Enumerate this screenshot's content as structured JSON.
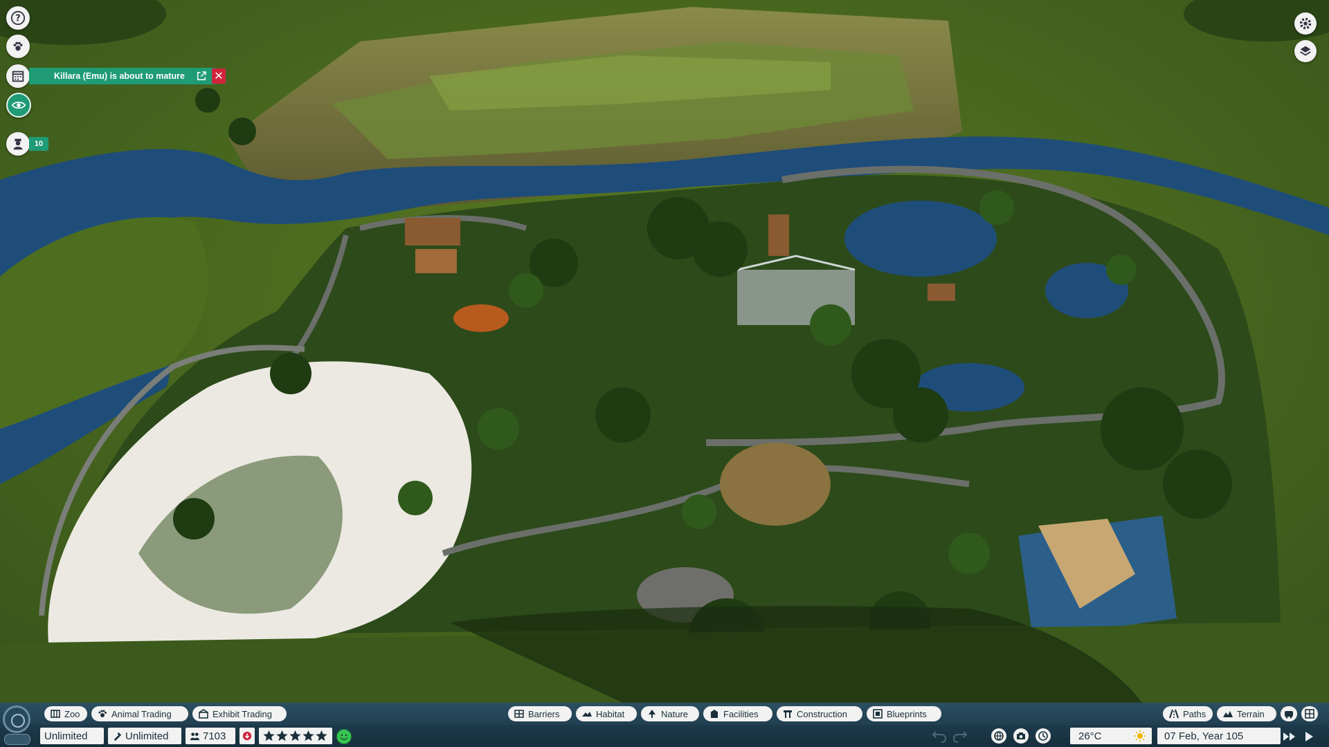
{
  "notification": {
    "message": "Killara (Emu) is about to mature"
  },
  "guest_count_badge": "10",
  "toolbar": {
    "left_tabs": [
      {
        "label": "Zoo",
        "icon": "zoo-icon"
      },
      {
        "label": "Animal Trading",
        "icon": "paw-icon"
      },
      {
        "label": "Exhibit Trading",
        "icon": "exhibit-icon"
      }
    ],
    "center_tabs": [
      {
        "label": "Barriers",
        "icon": "barrier-icon"
      },
      {
        "label": "Habitat",
        "icon": "habitat-icon"
      },
      {
        "label": "Nature",
        "icon": "tree-icon"
      },
      {
        "label": "Facilities",
        "icon": "facilities-icon"
      },
      {
        "label": "Construction",
        "icon": "construction-icon"
      },
      {
        "label": "Blueprints",
        "icon": "blueprint-icon"
      }
    ],
    "right_tabs": [
      {
        "label": "Paths",
        "icon": "paths-icon"
      },
      {
        "label": "Terrain",
        "icon": "terrain-icon"
      }
    ]
  },
  "status": {
    "money": "Unlimited",
    "research": "Unlimited",
    "guests": "7103",
    "star_rating": 5,
    "temperature": "26°C",
    "date": "07 Feb, Year 105",
    "weather_icon": "sun-icon"
  },
  "colors": {
    "accent_green": "#1f9b76",
    "close_red": "#d1243c",
    "hud_blue": "#213f51"
  }
}
